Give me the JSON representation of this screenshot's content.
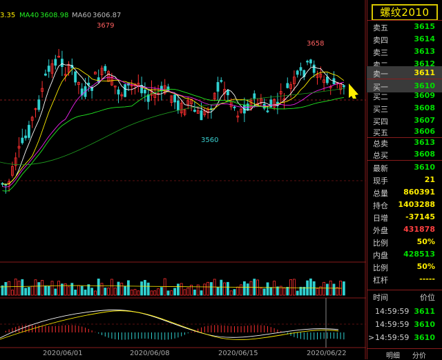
{
  "indicators": {
    "ma_first": "3.35",
    "ma40_label": "MA40",
    "ma40_value": "3608.98",
    "ma60_label": "MA60",
    "ma60_value": "3606.87"
  },
  "annotations": {
    "high1": "3679",
    "high2": "3658",
    "low1": "3560"
  },
  "dates": [
    "2020/06/01",
    "2020/06/08",
    "2020/06/15",
    "2020/06/22"
  ],
  "title": "螺纹2010",
  "title_mark": "N",
  "order_book": {
    "asks": [
      {
        "label": "卖五",
        "price": "3615"
      },
      {
        "label": "卖四",
        "price": "3614"
      },
      {
        "label": "卖三",
        "price": "3613"
      },
      {
        "label": "卖二",
        "price": "3612"
      },
      {
        "label": "卖一",
        "price": "3611"
      }
    ],
    "bids": [
      {
        "label": "买一",
        "price": "3610"
      },
      {
        "label": "买二",
        "price": "3609"
      },
      {
        "label": "买三",
        "price": "3608"
      },
      {
        "label": "买四",
        "price": "3607"
      },
      {
        "label": "买五",
        "price": "3606"
      }
    ],
    "total_sell_label": "总卖",
    "total_sell": "3613",
    "total_buy_label": "总买",
    "total_buy": "3608"
  },
  "quote": [
    {
      "label": "最新",
      "value": "3610",
      "color": "green"
    },
    {
      "label": "现手",
      "value": "21",
      "color": "yellow"
    },
    {
      "label": "总量",
      "value": "860391",
      "color": "yellow"
    },
    {
      "label": "持仓",
      "value": "1403288",
      "color": "yellow"
    },
    {
      "label": "日增",
      "value": "-37145",
      "color": "yellow"
    },
    {
      "label": "外盘",
      "value": "431878",
      "color": "red"
    },
    {
      "label": "比例",
      "value": "50%",
      "color": "yellow"
    },
    {
      "label": "内盘",
      "value": "428513",
      "color": "green"
    },
    {
      "label": "比例",
      "value": "50%",
      "color": "yellow"
    },
    {
      "label": "杠杆",
      "value": "-----",
      "color": "yellow"
    }
  ],
  "ticks_header": {
    "time": "时间",
    "price": "价位"
  },
  "ticks": [
    {
      "time": "14:59:59",
      "price": "3611",
      "marker": ""
    },
    {
      "time": "14:59:59",
      "price": "3610",
      "marker": ""
    },
    {
      "time": "14:59:59",
      "price": "3610",
      "marker": ">"
    }
  ],
  "tabs": [
    "明细",
    "分价"
  ],
  "colors": {
    "up": "#ff3030",
    "down": "#30d0d0",
    "ma_white": "#ffffff",
    "ma_yellow": "#ffee00",
    "ma_magenta": "#ee22ee",
    "ma_green": "#22ee22",
    "border": "#8a1c1c"
  }
}
